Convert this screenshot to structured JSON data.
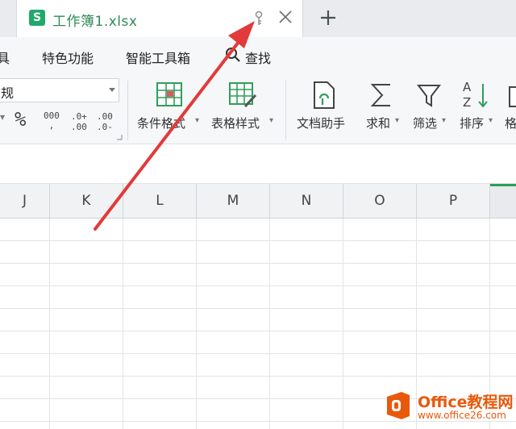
{
  "tab": {
    "logo": "S",
    "title": "工作簿1.xlsx",
    "icons": [
      "key-icon",
      "close-icon"
    ],
    "new_tab_icon": "plus-icon"
  },
  "menu": {
    "items": [
      "具",
      "特色功能",
      "智能工具箱",
      "查找"
    ],
    "search_icon": "search-icon"
  },
  "ribbon": {
    "format_select_value": "规",
    "percent": "%",
    "thousands": "000",
    "inc_decimal_top": ".0+",
    "inc_decimal_bottom": ".00",
    "dec_decimal_top": ".00",
    "dec_decimal_bottom": ".0-",
    "cond_format": "条件格式",
    "table_style": "表格样式",
    "doc_assistant": "文档助手",
    "sum": "求和",
    "filter": "筛选",
    "sort": "排序",
    "format_partial": "格"
  },
  "columns": [
    "J",
    "K",
    "L",
    "M",
    "N",
    "O",
    "P",
    ""
  ],
  "watermark": {
    "title": "Office教程网",
    "url": "www.office26.com"
  },
  "colors": {
    "tab_title": "#2e8b57",
    "logo_green": "#1faa6b",
    "arrow_red": "#e23a3a",
    "watermark_orange": "#e8590c"
  }
}
